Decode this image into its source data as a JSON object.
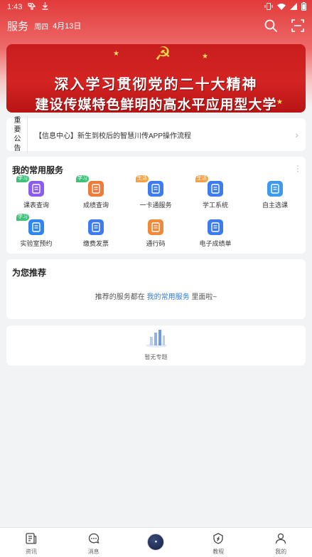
{
  "status_bar": {
    "time": "1:43",
    "left_icons": [
      "app-notification-icon",
      "download-icon"
    ],
    "right_icons": [
      "vibrate-icon",
      "wifi-icon",
      "signal-icon",
      "battery-icon"
    ]
  },
  "header": {
    "title": "服务",
    "weekday": "周四",
    "date": "4月13日",
    "icons": [
      "search-icon",
      "scan-icon"
    ]
  },
  "banner": {
    "line1": "深入学习贯彻党的二十大精神",
    "line2": "建设传媒特色鲜明的高水平应用型大学",
    "emblem": "hammer-sickle-emblem"
  },
  "notice": {
    "tag": "重要公告",
    "text": "【信息中心】新生到校后的智慧川传APP操作流程"
  },
  "services": {
    "title": "我的常用服务",
    "items": [
      {
        "label": "课表查询",
        "badge": "学习",
        "badge_color": "green",
        "icon": "timetable-icon",
        "color": "#8a5cf0"
      },
      {
        "label": "成绩查询",
        "badge": "学习",
        "badge_color": "green",
        "icon": "grades-icon",
        "color": "#f07a3a"
      },
      {
        "label": "一卡通服务",
        "badge": "生活",
        "badge_color": "orange",
        "icon": "card-service-icon",
        "color": "#3d7bf0"
      },
      {
        "label": "学工系统",
        "badge": "生活",
        "badge_color": "orange",
        "icon": "student-affairs-icon",
        "color": "#3d7bf0"
      },
      {
        "label": "自主选课",
        "badge": "",
        "badge_color": "",
        "icon": "course-selection-icon",
        "color": "#3d9af0"
      },
      {
        "label": "实验室预约",
        "badge": "学习",
        "badge_color": "green",
        "icon": "lab-booking-icon",
        "color": "#2f86f0"
      },
      {
        "label": "缴费发票",
        "badge": "",
        "badge_color": "",
        "icon": "invoice-icon",
        "color": "#3d7bf0"
      },
      {
        "label": "通行码",
        "badge": "",
        "badge_color": "",
        "icon": "pass-code-icon",
        "color": "#f08a3a"
      },
      {
        "label": "电子成绩单",
        "badge": "",
        "badge_color": "",
        "icon": "transcript-icon",
        "color": "#3d7bf0"
      }
    ]
  },
  "recommend": {
    "title": "为您推荐",
    "text_before": "推荐的服务都在",
    "link": "我的常用服务",
    "text_after": "里面啦~"
  },
  "topics": {
    "empty_text": "暂无专题"
  },
  "tabbar": {
    "tabs": [
      {
        "label": "资讯",
        "icon": "news-icon"
      },
      {
        "label": "消息",
        "icon": "message-icon"
      },
      {
        "label": "",
        "icon": "campus-logo-icon"
      },
      {
        "label": "教程",
        "icon": "tutorial-icon"
      },
      {
        "label": "我的",
        "icon": "profile-icon"
      }
    ]
  }
}
